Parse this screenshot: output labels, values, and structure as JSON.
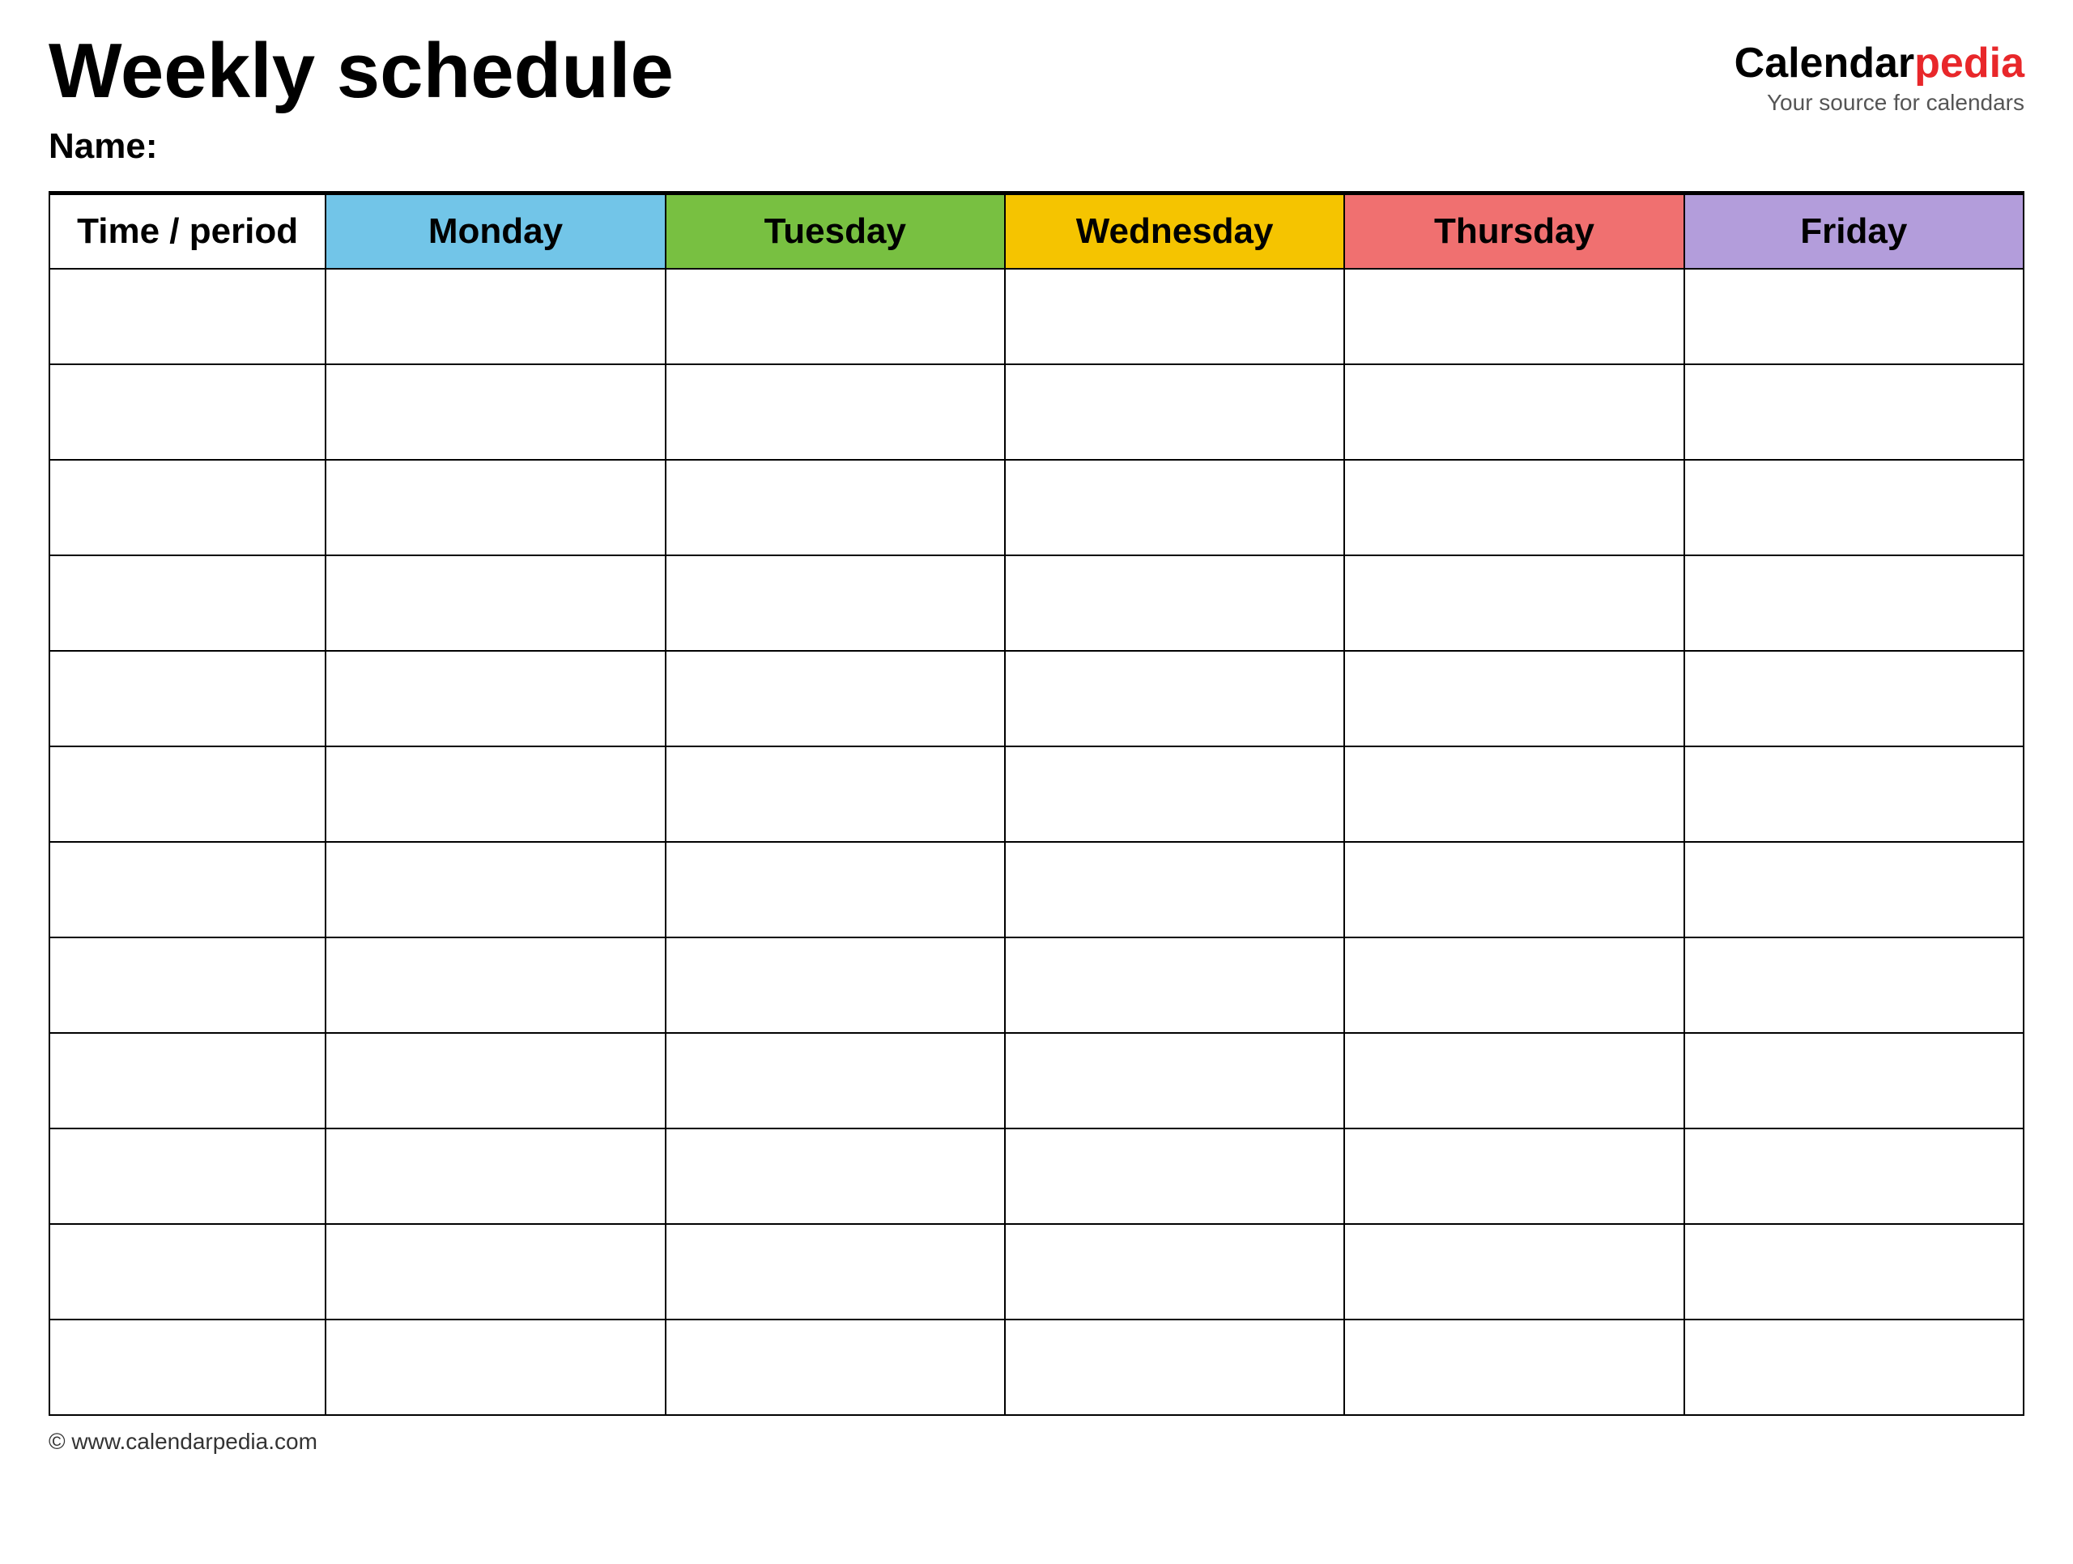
{
  "header": {
    "title": "Weekly schedule",
    "name_label": "Name:",
    "logo_calendar": "Calendar",
    "logo_pedia": "pedia",
    "logo_subtitle": "Your source for calendars"
  },
  "table": {
    "columns": [
      {
        "key": "time",
        "label": "Time / period",
        "color": "#ffffff"
      },
      {
        "key": "monday",
        "label": "Monday",
        "color": "#72c5e8"
      },
      {
        "key": "tuesday",
        "label": "Tuesday",
        "color": "#78c041"
      },
      {
        "key": "wednesday",
        "label": "Wednesday",
        "color": "#f5c400"
      },
      {
        "key": "thursday",
        "label": "Thursday",
        "color": "#f07070"
      },
      {
        "key": "friday",
        "label": "Friday",
        "color": "#b39ddb"
      }
    ],
    "row_count": 12
  },
  "footer": {
    "url": "© www.calendarpedia.com"
  }
}
